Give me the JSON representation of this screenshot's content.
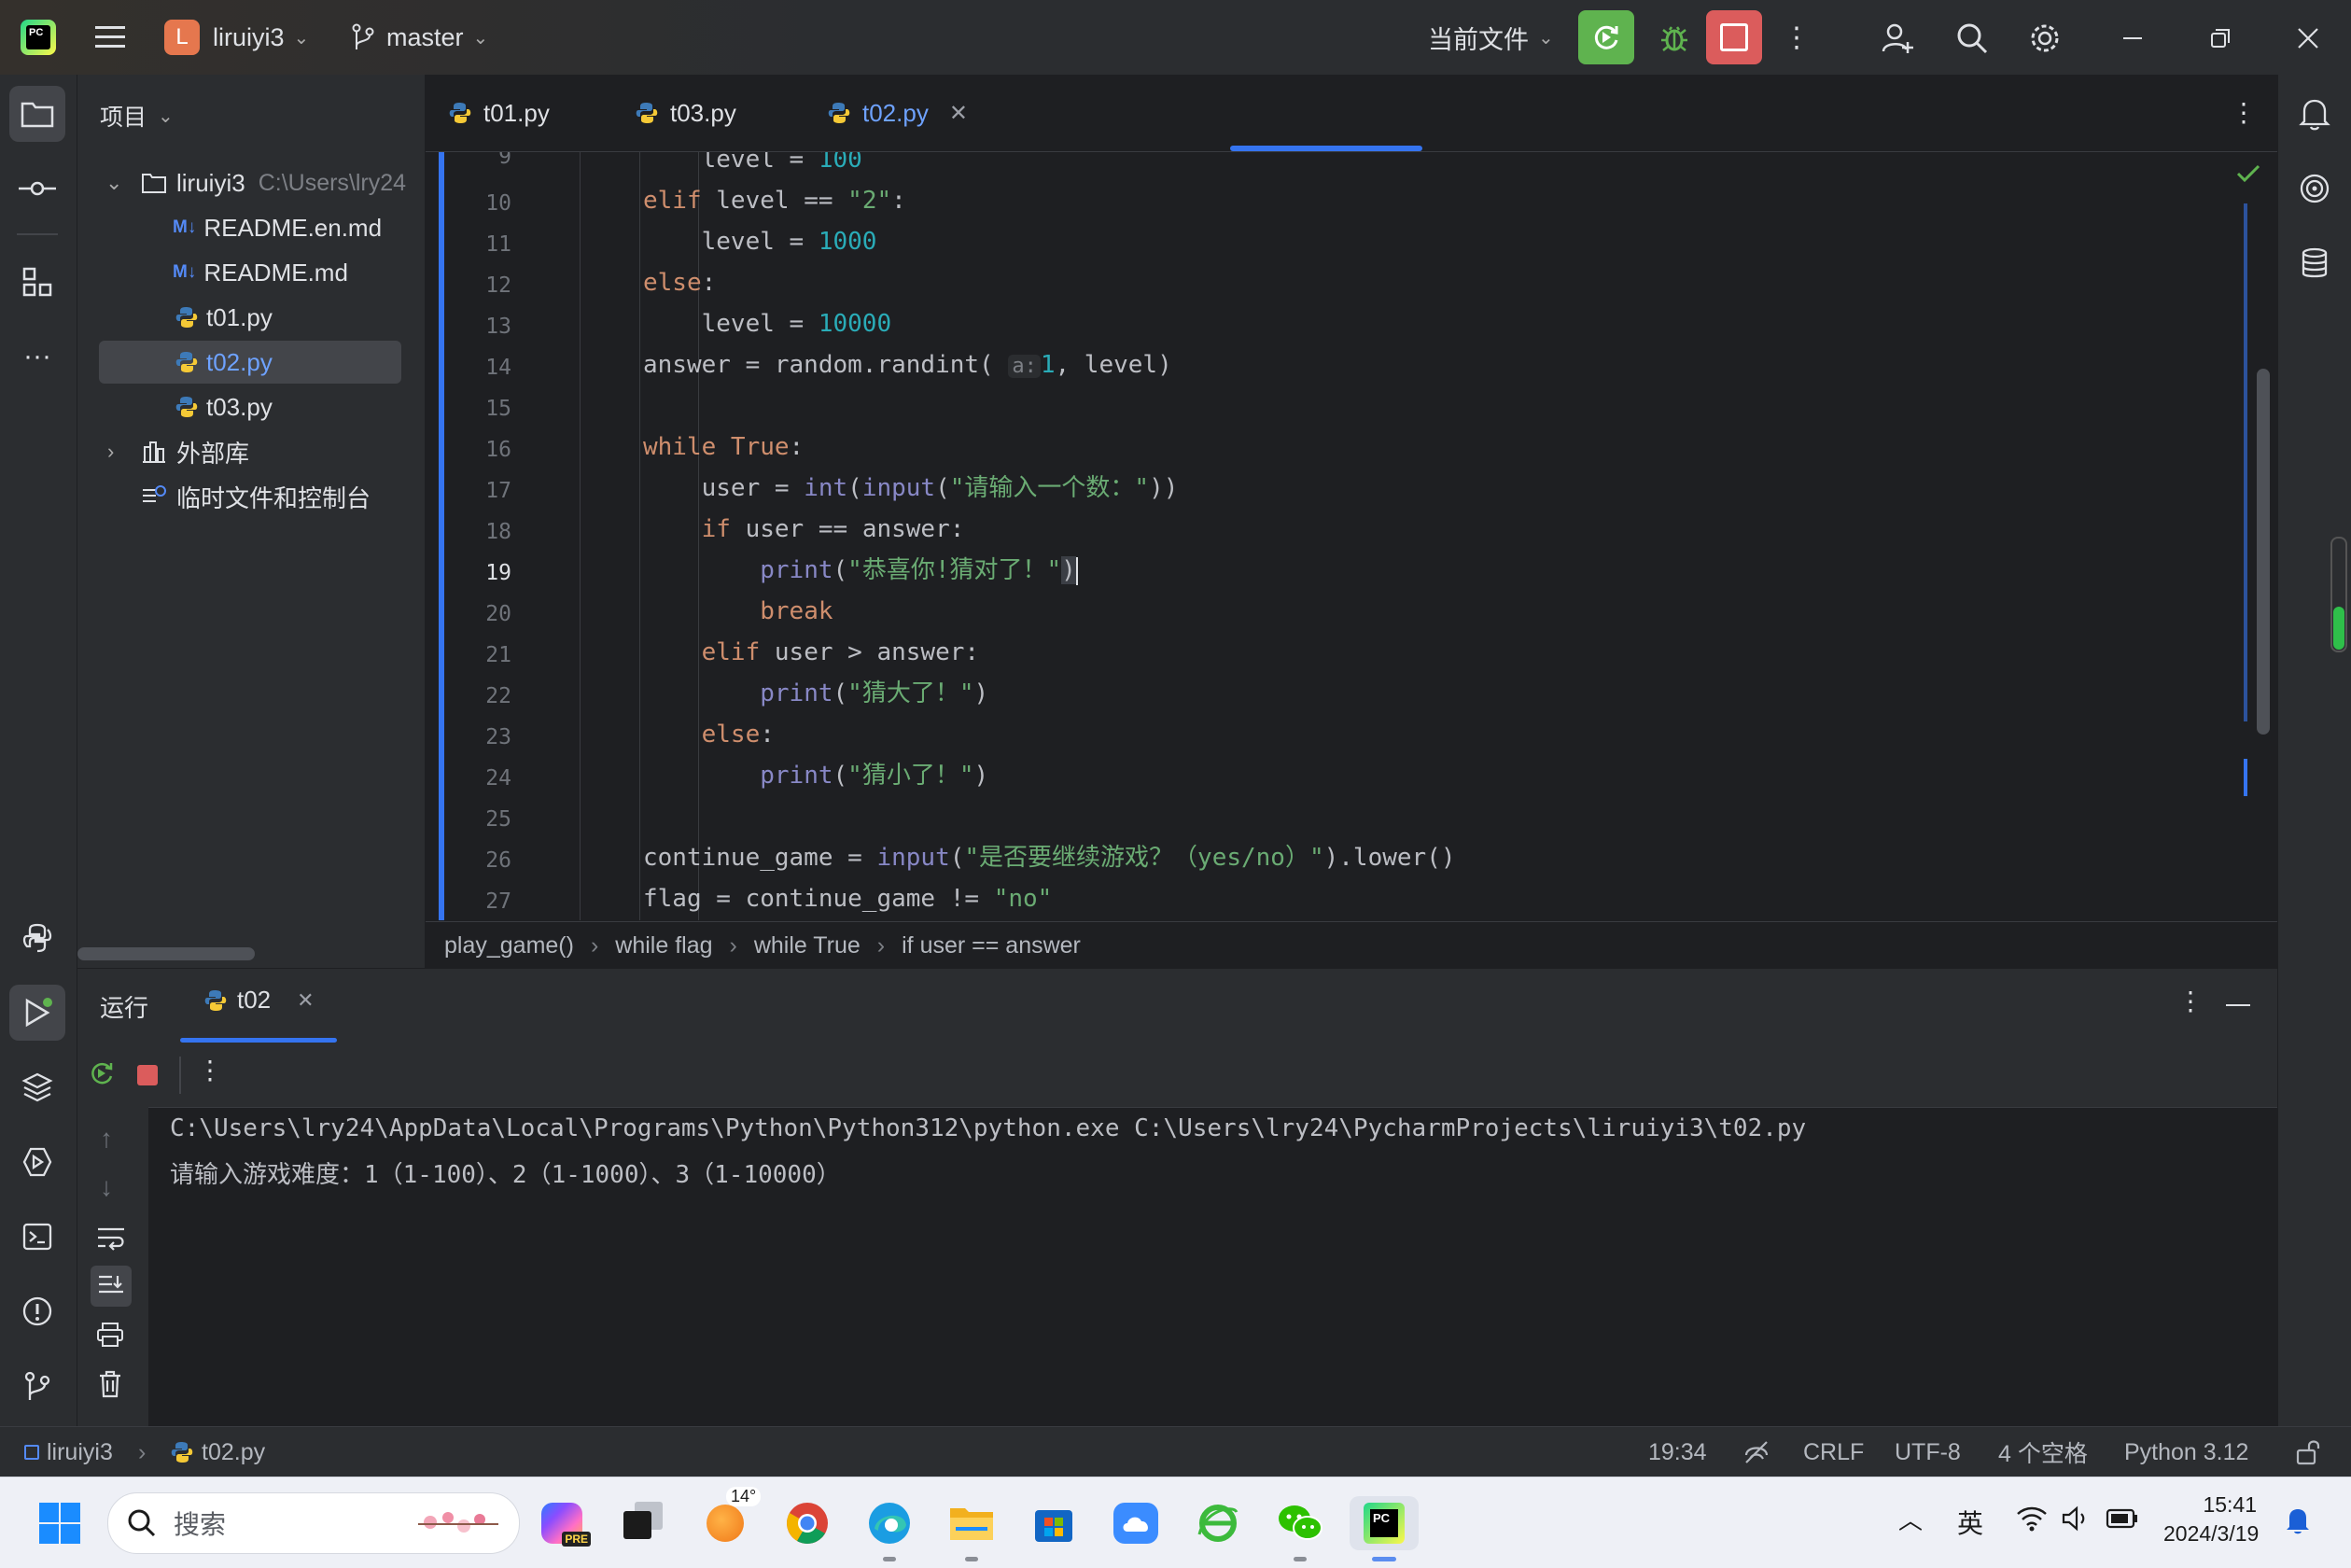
{
  "titlebar": {
    "project_initial": "L",
    "project_name": "liruiyi3",
    "branch": "master",
    "run_config": "当前文件"
  },
  "project_panel": {
    "header": "项目",
    "root_name": "liruiyi3",
    "root_path": "C:\\Users\\lry24",
    "files": [
      "README.en.md",
      "README.md",
      "t01.py",
      "t02.py",
      "t03.py"
    ],
    "external": "外部库",
    "scratches": "临时文件和控制台"
  },
  "tabs": [
    "t01.py",
    "t03.py",
    "t02.py"
  ],
  "editor": {
    "line_numbers": [
      "9",
      "10",
      "11",
      "12",
      "13",
      "14",
      "15",
      "16",
      "17",
      "18",
      "19",
      "20",
      "21",
      "22",
      "23",
      "24",
      "25",
      "26",
      "27"
    ],
    "param_hint": "a:"
  },
  "breadcrumb": [
    "play_game()",
    "while flag",
    "while True",
    "if user == answer"
  ],
  "run": {
    "title": "运行",
    "tab": "t02",
    "console": [
      "C:\\Users\\lry24\\AppData\\Local\\Programs\\Python\\Python312\\python.exe C:\\Users\\lry24\\PycharmProjects\\liruiyi3\\t02.py",
      "请输入游戏难度：1（1-100）、2（1-1000）、3（1-10000）"
    ]
  },
  "statusbar": {
    "project": "liruiyi3",
    "file": "t02.py",
    "position": "19:34",
    "line_sep": "CRLF",
    "encoding": "UTF-8",
    "indent": "4 个空格",
    "interpreter": "Python 3.12"
  },
  "taskbar": {
    "search_placeholder": "搜索",
    "weather": "14°",
    "ime": "英",
    "time": "15:41",
    "date": "2024/3/19"
  },
  "colors": {
    "accent": "#3574f0",
    "run_green": "#5fb34f",
    "stop_red": "#db5c5c",
    "keyword": "#cf8e6d",
    "string": "#6aab73",
    "number": "#2aacb8"
  }
}
